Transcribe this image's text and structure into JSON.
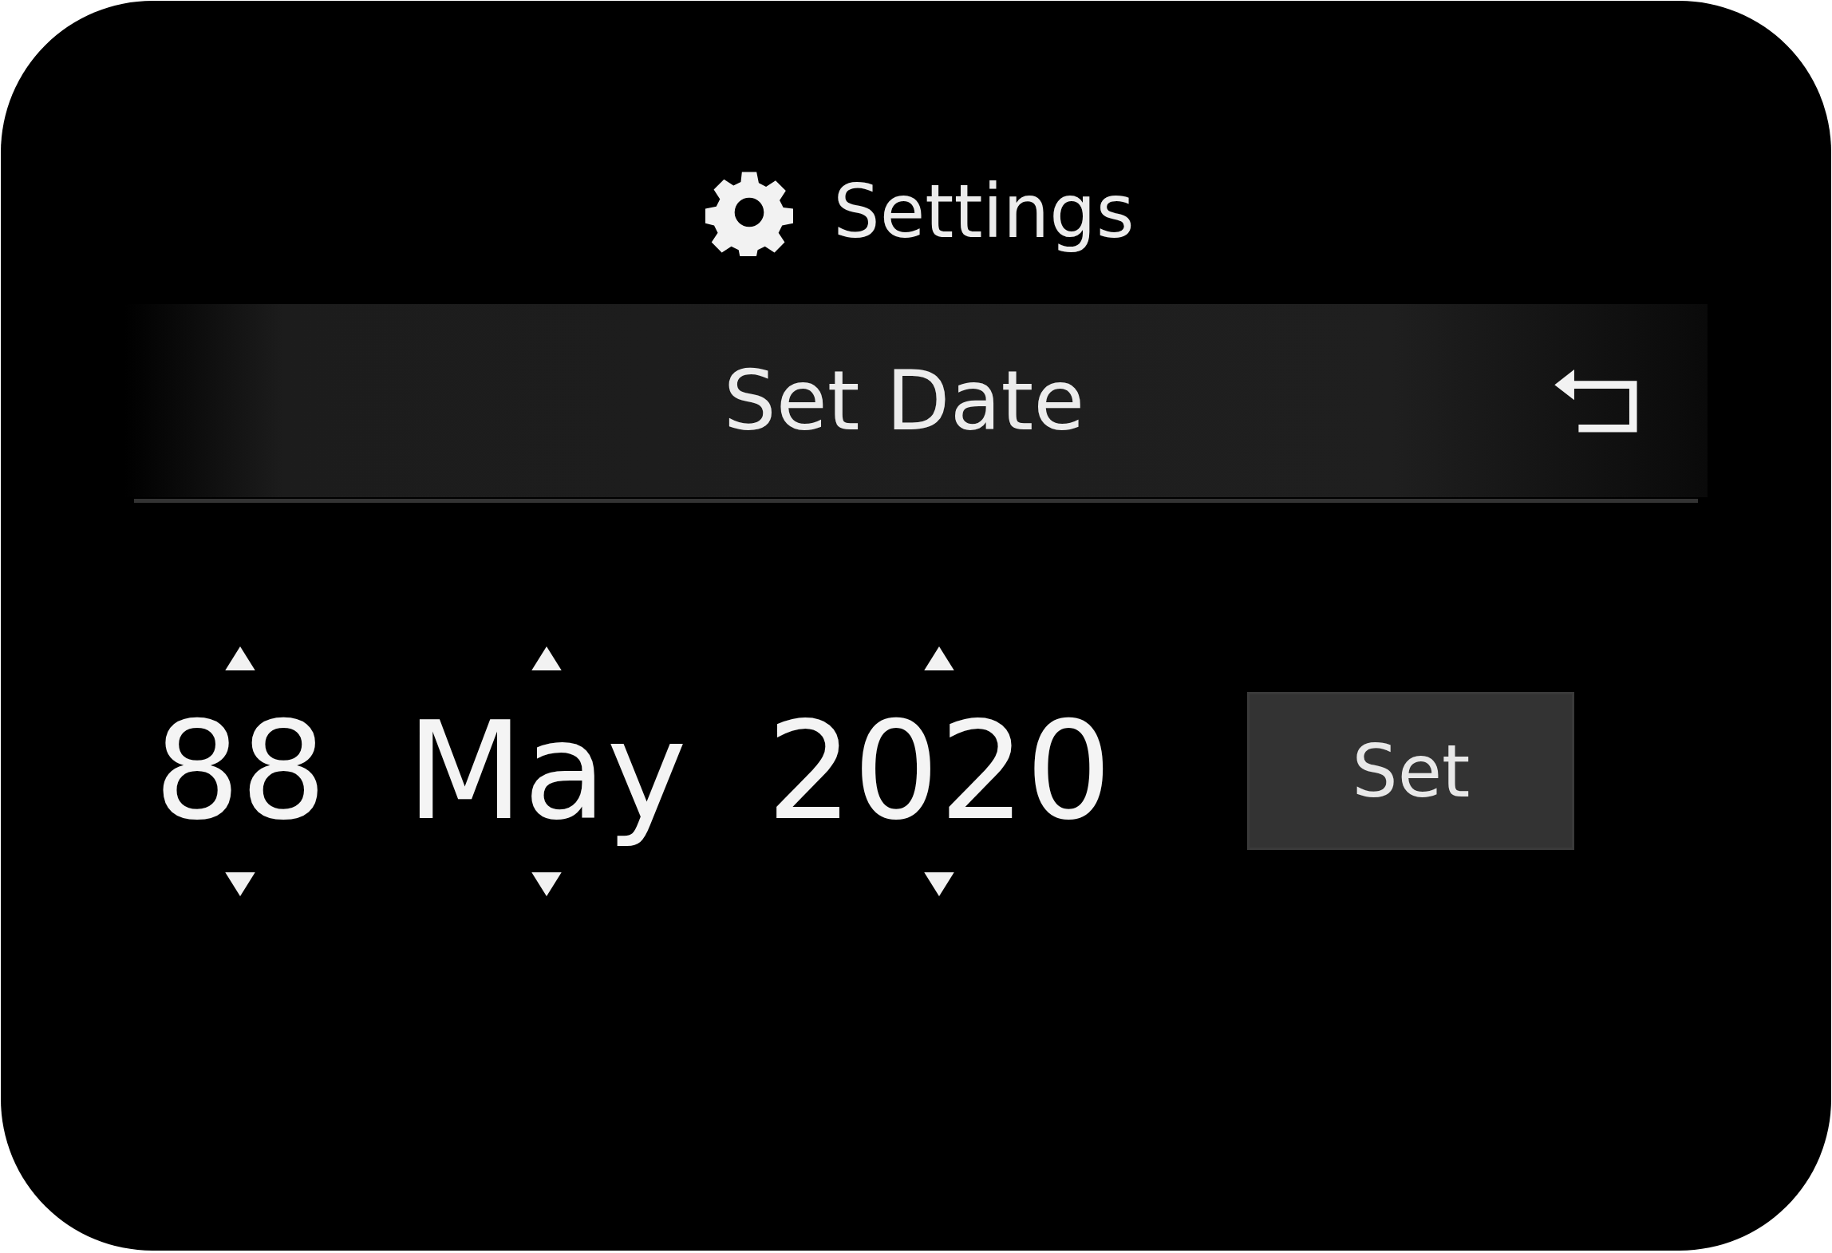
{
  "header": {
    "title": "Settings"
  },
  "title_bar": {
    "title": "Set Date"
  },
  "date_fields": [
    {
      "value": "88"
    },
    {
      "value": "May"
    },
    {
      "value": "2020"
    }
  ],
  "set_button": {
    "label": "Set"
  }
}
